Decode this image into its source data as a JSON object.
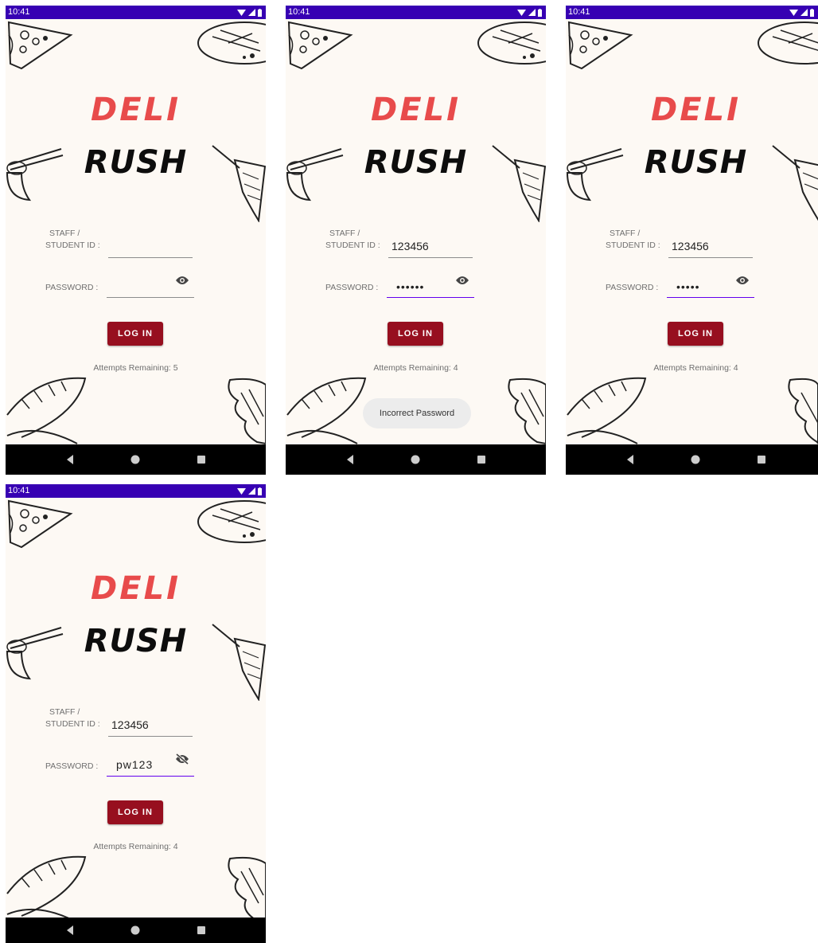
{
  "screens": [
    {
      "status_time": "10:41",
      "title_line1": "DELI",
      "title_line2": "RUSH",
      "id_label_line1": "STAFF /",
      "id_label_line2": "STUDENT ID :",
      "id_value": "",
      "password_label": "PASSWORD :",
      "password_value": "",
      "password_visibility_icon": "eye-icon",
      "login_label": "LOG IN",
      "attempts_text": "Attempts Remaining: 5",
      "toast": ""
    },
    {
      "status_time": "10:41",
      "title_line1": "DELI",
      "title_line2": "RUSH",
      "id_label_line1": "STAFF /",
      "id_label_line2": "STUDENT ID :",
      "id_value": "123456",
      "password_label": "PASSWORD :",
      "password_value": "••••••",
      "password_visibility_icon": "eye-icon",
      "login_label": "LOG IN",
      "attempts_text": "Attempts Remaining: 4",
      "toast": "Incorrect Password"
    },
    {
      "status_time": "10:41",
      "title_line1": "DELI",
      "title_line2": "RUSH",
      "id_label_line1": "STAFF /",
      "id_label_line2": "STUDENT ID :",
      "id_value": "123456",
      "password_label": "PASSWORD :",
      "password_value": "•••••",
      "password_visibility_icon": "eye-icon",
      "login_label": "LOG IN",
      "attempts_text": "Attempts Remaining: 4",
      "toast": ""
    },
    {
      "status_time": "10:41",
      "title_line1": "DELI",
      "title_line2": "RUSH",
      "id_label_line1": "STAFF /",
      "id_label_line2": "STUDENT ID :",
      "id_value": "123456",
      "password_label": "PASSWORD :",
      "password_value": "pw123",
      "password_visibility_icon": "eye-off-icon",
      "login_label": "LOG IN",
      "attempts_text": "Attempts Remaining: 4",
      "toast": ""
    }
  ],
  "colors": {
    "status_bar": "#3700b3",
    "background": "#fdf9f4",
    "title_red": "#e84b4b",
    "button": "#970f1f",
    "focus_underline": "#6200ee"
  }
}
